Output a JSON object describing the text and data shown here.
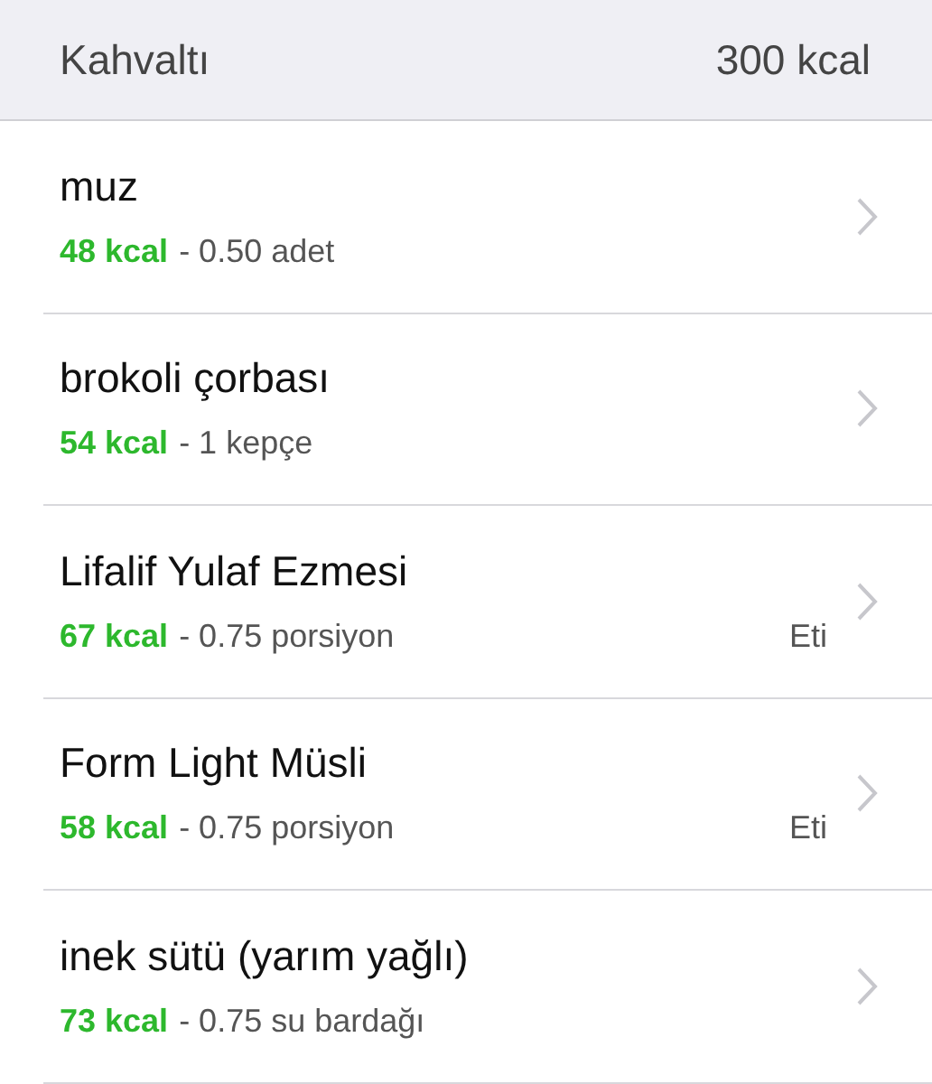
{
  "section": {
    "title": "Kahvaltı",
    "total": "300 kcal"
  },
  "items": [
    {
      "name": "muz",
      "kcal": "48 kcal",
      "portion": "- 0.50 adet"
    },
    {
      "name": "brokoli çorbası",
      "kcal": "54 kcal",
      "portion": "- 1 kepçe"
    },
    {
      "name": "Lifalif Yulaf Ezmesi",
      "kcal": "67 kcal",
      "portion": "- 0.75 porsiyon",
      "brand": "Eti"
    },
    {
      "name": "Form Light Müsli",
      "kcal": "58 kcal",
      "portion": "- 0.75 porsiyon",
      "brand": "Eti"
    },
    {
      "name": "inek sütü (yarım yağlı)",
      "kcal": "73 kcal",
      "portion": "- 0.75 su bardağı"
    }
  ]
}
